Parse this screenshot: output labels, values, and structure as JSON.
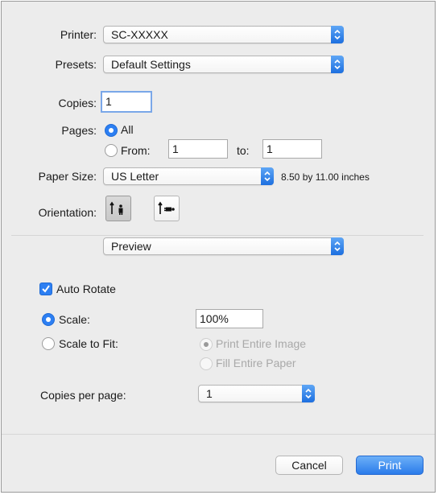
{
  "printer": {
    "label": "Printer:",
    "value": "SC-XXXXX"
  },
  "presets": {
    "label": "Presets:",
    "value": "Default Settings"
  },
  "copies": {
    "label": "Copies:",
    "value": "1"
  },
  "pages": {
    "label": "Pages:",
    "all_label": "All",
    "from_label": "From:",
    "from_value": "1",
    "to_label": "to:",
    "to_value": "1",
    "selected": "all"
  },
  "paper_size": {
    "label": "Paper Size:",
    "value": "US Letter",
    "dimensions": "8.50 by 11.00 inches"
  },
  "orientation": {
    "label": "Orientation:",
    "options": [
      "portrait-icon",
      "landscape-icon"
    ],
    "selected": "portrait"
  },
  "section": {
    "value": "Preview"
  },
  "auto_rotate": {
    "label": "Auto Rotate",
    "checked": true
  },
  "scale": {
    "label": "Scale:",
    "value": "100%",
    "selected": true
  },
  "scale_to_fit": {
    "label": "Scale to Fit:",
    "print_entire_image": "Print Entire Image",
    "fill_entire_paper": "Fill Entire Paper",
    "selected": false
  },
  "copies_per_page": {
    "label": "Copies per page:",
    "value": "1"
  },
  "buttons": {
    "cancel": "Cancel",
    "print": "Print"
  },
  "colors": {
    "accent": "#2d7ff2",
    "dialog_bg": "#ececec"
  }
}
